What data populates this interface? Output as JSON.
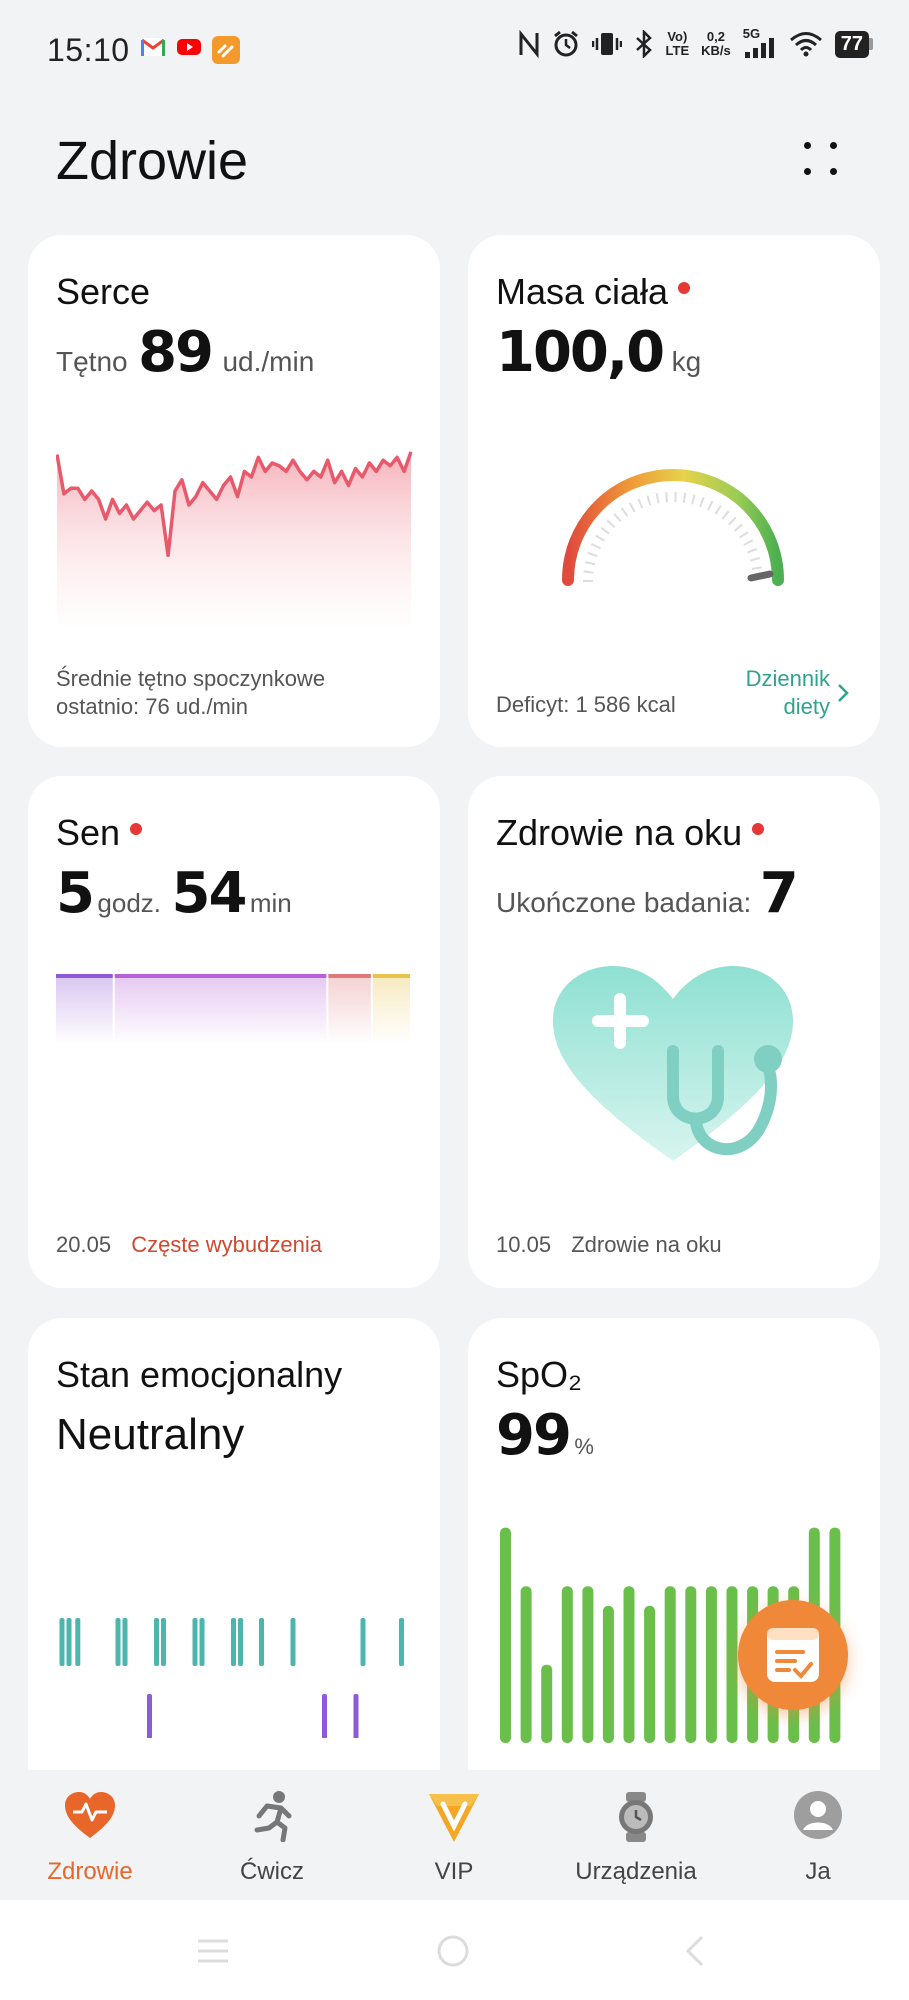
{
  "status_bar": {
    "time": "15:10",
    "network_speed": "0,2\nKB/s",
    "network_type": "5G",
    "volte": "Vo)\nLTE",
    "battery": "77",
    "notification_icons": [
      "gmail-icon",
      "youtube-icon",
      "orange-app-icon"
    ],
    "system_icons": [
      "nfc-icon",
      "alarm-icon",
      "vibrate-icon",
      "bluetooth-icon",
      "volte-icon",
      "speed-icon",
      "signal-icon",
      "wifi-icon",
      "battery-icon"
    ]
  },
  "header": {
    "title": "Zdrowie"
  },
  "cards": {
    "heart": {
      "title": "Serce",
      "metric_label": "Tętno",
      "value": "89",
      "unit": "ud./min",
      "footer_line1": "Średnie tętno spoczynkowe",
      "footer_line2": "ostatnio: 76 ud./min",
      "chart_color": "#e85a6b"
    },
    "weight": {
      "title": "Masa ciała",
      "value": "100,0",
      "unit": "kg",
      "footer": "Deficyt: 1 586 kcal",
      "link_line1": "Dziennik",
      "link_line2": "diety",
      "link_color": "#2ea38f"
    },
    "sleep": {
      "title": "Sen",
      "hours": "5",
      "hours_unit": "godz.",
      "minutes": "54",
      "minutes_unit": "min",
      "date": "20.05",
      "note": "Częste wybudzenia",
      "note_color": "#d0492f"
    },
    "eye": {
      "title": "Zdrowie na oku",
      "metric_label": "Ukończone badania:",
      "value": "7",
      "date": "10.05",
      "footer": "Zdrowie na oku"
    },
    "mood": {
      "title": "Stan emocjonalny",
      "value": "Neutralny"
    },
    "spo2": {
      "title": "SpO₂",
      "value": "99",
      "unit": "%"
    }
  },
  "chart_data": [
    {
      "type": "line",
      "title": "Serce",
      "values": [
        88,
        74,
        76,
        76,
        72,
        75,
        72,
        65,
        72,
        67,
        70,
        65,
        68,
        71,
        68,
        70,
        52,
        75,
        79,
        70,
        73,
        78,
        75,
        72,
        77,
        80,
        73,
        82,
        80,
        87,
        82,
        85,
        84,
        82,
        86,
        82,
        79,
        82,
        80,
        86,
        78,
        82,
        77,
        83,
        80,
        85,
        82,
        86,
        84,
        87,
        82,
        89
      ],
      "ylim": [
        45,
        95
      ],
      "color": "#e85a6b"
    },
    {
      "type": "bar",
      "title": "Sen",
      "stages": [
        {
          "name": "deep",
          "fraction": 0.165,
          "color": "#8e5ad8"
        },
        {
          "name": "light",
          "fraction": 0.6,
          "color": "#b660d9"
        },
        {
          "name": "rem",
          "fraction": 0.125,
          "color": "#e0787b"
        },
        {
          "name": "awake",
          "fraction": 0.11,
          "color": "#e8c24a"
        }
      ]
    },
    {
      "type": "scatter",
      "title": "Stan emocjonalny",
      "teal_marks": [
        0.01,
        0.03,
        0.055,
        0.17,
        0.19,
        0.28,
        0.3,
        0.39,
        0.41,
        0.5,
        0.52,
        0.58,
        0.67,
        0.87,
        0.98
      ],
      "purple_marks": [
        0.26,
        0.76,
        0.85
      ],
      "teal_color": "#4db6ac",
      "purple_color": "#8e5ad8"
    },
    {
      "type": "bar",
      "title": "SpO₂",
      "values": [
        99,
        96,
        92,
        96,
        96,
        95,
        96,
        95,
        96,
        96,
        96,
        96,
        96,
        96,
        96,
        99,
        99
      ],
      "ylim": [
        88,
        100
      ],
      "color": "#6abf4b"
    }
  ],
  "fab": {
    "icon": "health-report-icon",
    "color": "#f0883a"
  },
  "bottom_nav": {
    "items": [
      {
        "label": "Zdrowie",
        "icon": "heart-pulse-icon",
        "active": true
      },
      {
        "label": "Ćwicz",
        "icon": "running-icon",
        "active": false
      },
      {
        "label": "VIP",
        "icon": "vip-icon",
        "active": false
      },
      {
        "label": "Urządzenia",
        "icon": "watch-icon",
        "active": false
      },
      {
        "label": "Ja",
        "icon": "avatar-icon",
        "active": false
      }
    ],
    "active_color": "#e8662a"
  },
  "system_nav": {
    "icons": [
      "recents-icon",
      "home-icon",
      "back-icon"
    ]
  }
}
